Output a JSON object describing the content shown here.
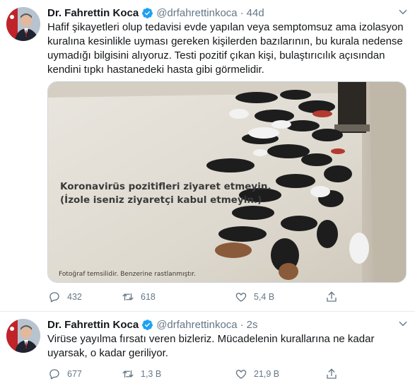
{
  "colors": {
    "verified": "#1da1f2",
    "icon": "#657786",
    "divider": "#e6ecf0"
  },
  "tweets": [
    {
      "author": {
        "name": "Dr. Fahrettin Koca",
        "handle": "@drfahrettinkoca",
        "verified": true
      },
      "separator": "·",
      "time": "44d",
      "text": "Hafif şikayetleri olup tedavisi evde yapılan veya semptomsuz ama izolasyon kuralına kesinlikle uyması gereken kişilerden bazılarının, bu kurala nedense uymadığı bilgisini alıyoruz. Testi pozitif çıkan kişi, bulaştırıcılık açısından kendini tıpkı hastanedeki hasta gibi görmelidir.",
      "media": {
        "overlay_line1": "Koronavirüs pozitifleri ziyaret etmeyin.",
        "overlay_line2": "(İzole iseniz ziyaretçi kabul etmeyin.)",
        "caption": "Fotoğraf temsilidir. Benzerine rastlanmıştır."
      },
      "actions": {
        "replies": "432",
        "retweets": "618",
        "likes": "5,4 B"
      }
    },
    {
      "author": {
        "name": "Dr. Fahrettin Koca",
        "handle": "@drfahrettinkoca",
        "verified": true
      },
      "separator": "·",
      "time": "2s",
      "text": "Virüse yayılma fırsatı veren bizleriz. Mücadelenin kurallarına ne kadar uyarsak, o kadar geriliyor.",
      "actions": {
        "replies": "677",
        "retweets": "1,3 B",
        "likes": "21,9 B"
      }
    }
  ],
  "icons": {
    "chevron": "chevron-down-icon",
    "reply": "reply-icon",
    "retweet": "retweet-icon",
    "like": "heart-icon",
    "share": "share-icon",
    "verified": "verified-badge-icon"
  }
}
